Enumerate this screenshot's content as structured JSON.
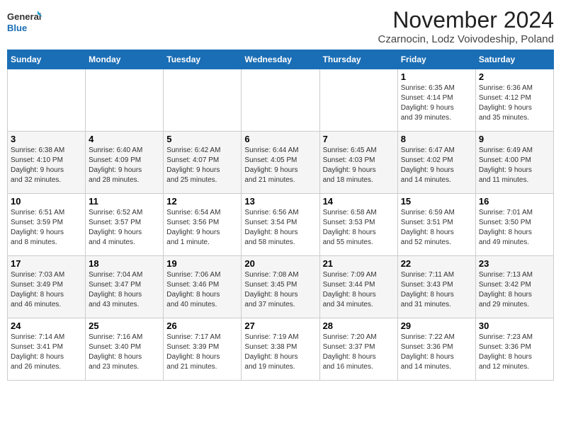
{
  "logo": {
    "text_general": "General",
    "text_blue": "Blue"
  },
  "title": "November 2024",
  "location": "Czarnocin, Lodz Voivodeship, Poland",
  "days_of_week": [
    "Sunday",
    "Monday",
    "Tuesday",
    "Wednesday",
    "Thursday",
    "Friday",
    "Saturday"
  ],
  "weeks": [
    [
      {
        "day": "",
        "info": ""
      },
      {
        "day": "",
        "info": ""
      },
      {
        "day": "",
        "info": ""
      },
      {
        "day": "",
        "info": ""
      },
      {
        "day": "",
        "info": ""
      },
      {
        "day": "1",
        "info": "Sunrise: 6:35 AM\nSunset: 4:14 PM\nDaylight: 9 hours\nand 39 minutes."
      },
      {
        "day": "2",
        "info": "Sunrise: 6:36 AM\nSunset: 4:12 PM\nDaylight: 9 hours\nand 35 minutes."
      }
    ],
    [
      {
        "day": "3",
        "info": "Sunrise: 6:38 AM\nSunset: 4:10 PM\nDaylight: 9 hours\nand 32 minutes."
      },
      {
        "day": "4",
        "info": "Sunrise: 6:40 AM\nSunset: 4:09 PM\nDaylight: 9 hours\nand 28 minutes."
      },
      {
        "day": "5",
        "info": "Sunrise: 6:42 AM\nSunset: 4:07 PM\nDaylight: 9 hours\nand 25 minutes."
      },
      {
        "day": "6",
        "info": "Sunrise: 6:44 AM\nSunset: 4:05 PM\nDaylight: 9 hours\nand 21 minutes."
      },
      {
        "day": "7",
        "info": "Sunrise: 6:45 AM\nSunset: 4:03 PM\nDaylight: 9 hours\nand 18 minutes."
      },
      {
        "day": "8",
        "info": "Sunrise: 6:47 AM\nSunset: 4:02 PM\nDaylight: 9 hours\nand 14 minutes."
      },
      {
        "day": "9",
        "info": "Sunrise: 6:49 AM\nSunset: 4:00 PM\nDaylight: 9 hours\nand 11 minutes."
      }
    ],
    [
      {
        "day": "10",
        "info": "Sunrise: 6:51 AM\nSunset: 3:59 PM\nDaylight: 9 hours\nand 8 minutes."
      },
      {
        "day": "11",
        "info": "Sunrise: 6:52 AM\nSunset: 3:57 PM\nDaylight: 9 hours\nand 4 minutes."
      },
      {
        "day": "12",
        "info": "Sunrise: 6:54 AM\nSunset: 3:56 PM\nDaylight: 9 hours\nand 1 minute."
      },
      {
        "day": "13",
        "info": "Sunrise: 6:56 AM\nSunset: 3:54 PM\nDaylight: 8 hours\nand 58 minutes."
      },
      {
        "day": "14",
        "info": "Sunrise: 6:58 AM\nSunset: 3:53 PM\nDaylight: 8 hours\nand 55 minutes."
      },
      {
        "day": "15",
        "info": "Sunrise: 6:59 AM\nSunset: 3:51 PM\nDaylight: 8 hours\nand 52 minutes."
      },
      {
        "day": "16",
        "info": "Sunrise: 7:01 AM\nSunset: 3:50 PM\nDaylight: 8 hours\nand 49 minutes."
      }
    ],
    [
      {
        "day": "17",
        "info": "Sunrise: 7:03 AM\nSunset: 3:49 PM\nDaylight: 8 hours\nand 46 minutes."
      },
      {
        "day": "18",
        "info": "Sunrise: 7:04 AM\nSunset: 3:47 PM\nDaylight: 8 hours\nand 43 minutes."
      },
      {
        "day": "19",
        "info": "Sunrise: 7:06 AM\nSunset: 3:46 PM\nDaylight: 8 hours\nand 40 minutes."
      },
      {
        "day": "20",
        "info": "Sunrise: 7:08 AM\nSunset: 3:45 PM\nDaylight: 8 hours\nand 37 minutes."
      },
      {
        "day": "21",
        "info": "Sunrise: 7:09 AM\nSunset: 3:44 PM\nDaylight: 8 hours\nand 34 minutes."
      },
      {
        "day": "22",
        "info": "Sunrise: 7:11 AM\nSunset: 3:43 PM\nDaylight: 8 hours\nand 31 minutes."
      },
      {
        "day": "23",
        "info": "Sunrise: 7:13 AM\nSunset: 3:42 PM\nDaylight: 8 hours\nand 29 minutes."
      }
    ],
    [
      {
        "day": "24",
        "info": "Sunrise: 7:14 AM\nSunset: 3:41 PM\nDaylight: 8 hours\nand 26 minutes."
      },
      {
        "day": "25",
        "info": "Sunrise: 7:16 AM\nSunset: 3:40 PM\nDaylight: 8 hours\nand 23 minutes."
      },
      {
        "day": "26",
        "info": "Sunrise: 7:17 AM\nSunset: 3:39 PM\nDaylight: 8 hours\nand 21 minutes."
      },
      {
        "day": "27",
        "info": "Sunrise: 7:19 AM\nSunset: 3:38 PM\nDaylight: 8 hours\nand 19 minutes."
      },
      {
        "day": "28",
        "info": "Sunrise: 7:20 AM\nSunset: 3:37 PM\nDaylight: 8 hours\nand 16 minutes."
      },
      {
        "day": "29",
        "info": "Sunrise: 7:22 AM\nSunset: 3:36 PM\nDaylight: 8 hours\nand 14 minutes."
      },
      {
        "day": "30",
        "info": "Sunrise: 7:23 AM\nSunset: 3:36 PM\nDaylight: 8 hours\nand 12 minutes."
      }
    ]
  ]
}
